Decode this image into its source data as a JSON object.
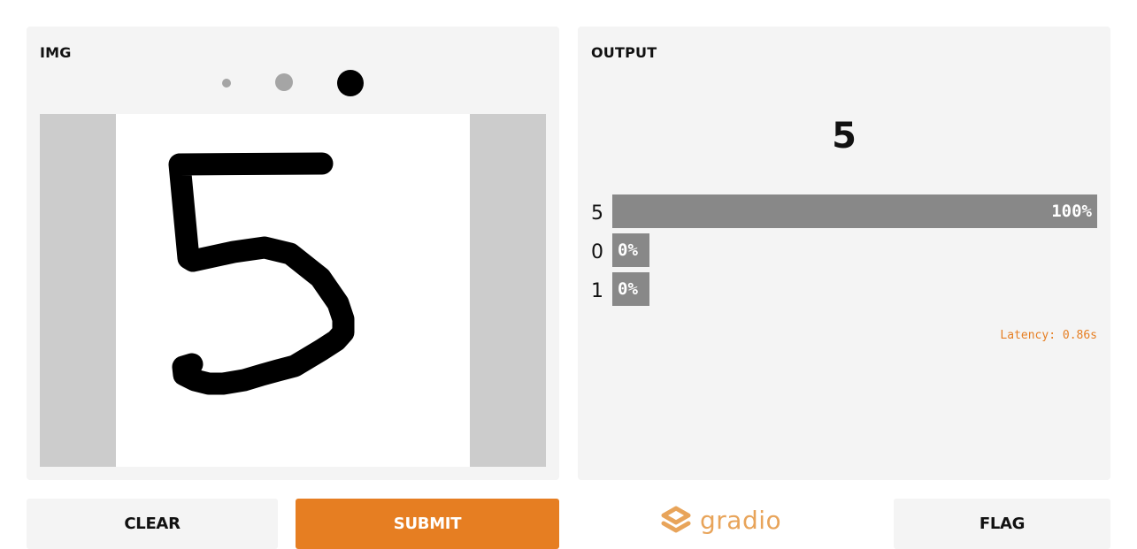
{
  "input": {
    "title": "IMG",
    "drawn_digit": "5"
  },
  "output": {
    "title": "OUTPUT",
    "predicted_label": "5",
    "confidences": [
      {
        "label": "5",
        "value_text": "100%",
        "value": 1.0
      },
      {
        "label": "0",
        "value_text": "0%",
        "value": 0.0
      },
      {
        "label": "1",
        "value_text": "0%",
        "value": 0.0
      }
    ],
    "latency": "Latency: 0.86s"
  },
  "buttons": {
    "clear": "CLEAR",
    "submit": "SUBMIT",
    "flag": "FLAG"
  },
  "logo": {
    "text": "gradio"
  },
  "colors": {
    "accent": "#e67e22",
    "panel_bg": "#f4f4f4",
    "bar": "#888888"
  }
}
